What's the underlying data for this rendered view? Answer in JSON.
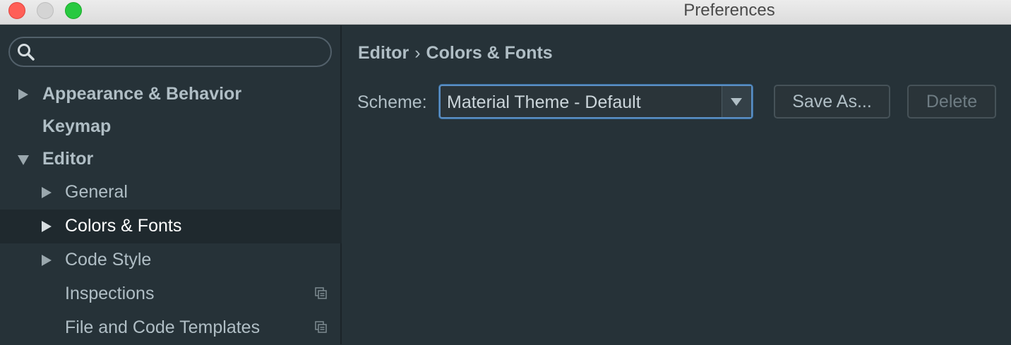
{
  "window": {
    "title": "Preferences"
  },
  "search": {
    "placeholder": "",
    "value": ""
  },
  "sidebar": {
    "items": [
      {
        "label": "Appearance & Behavior"
      },
      {
        "label": "Keymap"
      },
      {
        "label": "Editor"
      },
      {
        "label": "General"
      },
      {
        "label": "Colors & Fonts"
      },
      {
        "label": "Code Style"
      },
      {
        "label": "Inspections"
      },
      {
        "label": "File and Code Templates"
      }
    ]
  },
  "breadcrumb": {
    "parent": "Editor",
    "separator": "›",
    "current": "Colors & Fonts"
  },
  "scheme": {
    "label": "Scheme:",
    "selected": "Material Theme - Default",
    "save_as_label": "Save As...",
    "delete_label": "Delete"
  },
  "colors": {
    "background": "#263238",
    "selected_row": "#1f292e",
    "text": "#b0bec5",
    "focus_border": "#5b8fc4"
  },
  "icons": [
    "search-icon",
    "expand-arrow-icon",
    "collapse-arrow-icon",
    "project-settings-icon"
  ]
}
